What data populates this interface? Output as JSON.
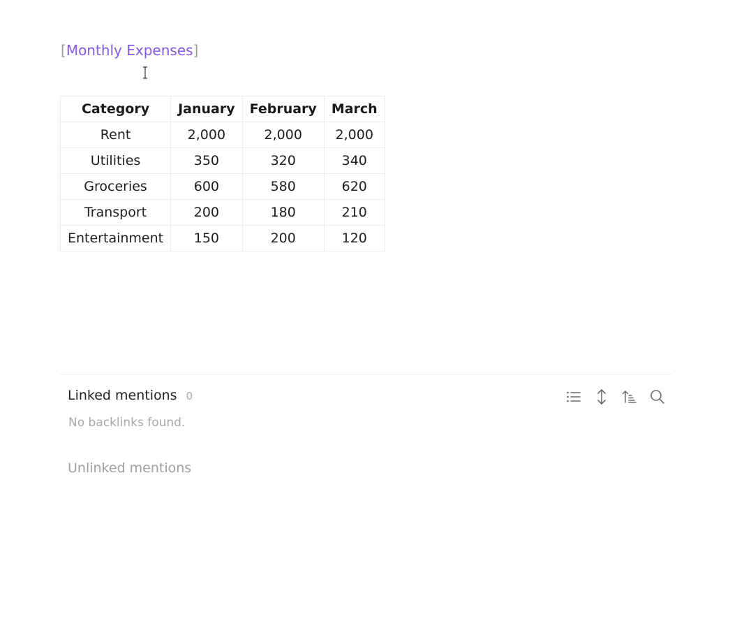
{
  "note_link": {
    "open_bracket": "[",
    "text": "Monthly Expenses",
    "close_bracket": "]"
  },
  "table": {
    "headers": [
      "Category",
      "January",
      "February",
      "March"
    ],
    "rows": [
      [
        "Rent",
        "2,000",
        "2,000",
        "2,000"
      ],
      [
        "Utilities",
        "350",
        "320",
        "340"
      ],
      [
        "Groceries",
        "600",
        "580",
        "620"
      ],
      [
        "Transport",
        "200",
        "180",
        "210"
      ],
      [
        "Entertainment",
        "150",
        "200",
        "120"
      ]
    ]
  },
  "backlinks": {
    "linked_title": "Linked mentions",
    "linked_count": "0",
    "empty_message": "No backlinks found.",
    "unlinked_title": "Unlinked mentions",
    "toolbar_icons": [
      "list-icon",
      "expand-collapse-icon",
      "sort-icon",
      "search-icon"
    ]
  },
  "colors": {
    "link": "#8559e0",
    "bracket": "#9a9a9a",
    "muted_text": "#a8a8a8",
    "border": "#ececec",
    "icon": "#6b6b6b"
  }
}
